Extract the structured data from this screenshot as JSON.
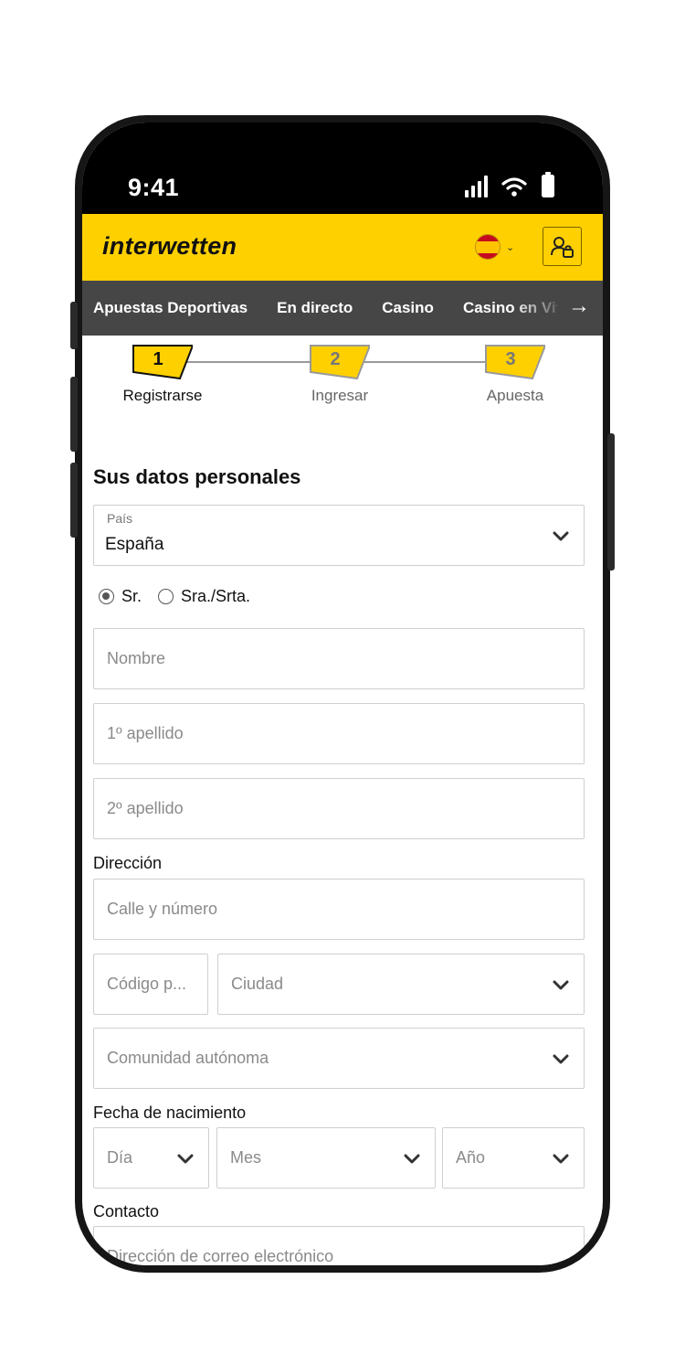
{
  "status_bar": {
    "time": "9:41"
  },
  "header": {
    "logo": "interwetten",
    "language": "ES"
  },
  "nav": {
    "items": [
      "Apuestas Deportivas",
      "En directo",
      "Casino",
      "Casino en Vivo"
    ]
  },
  "stepper": {
    "steps": [
      {
        "number": "1",
        "label": "Registrarse",
        "active": true
      },
      {
        "number": "2",
        "label": "Ingresar",
        "active": false
      },
      {
        "number": "3",
        "label": "Apuesta",
        "active": false
      }
    ]
  },
  "form": {
    "title": "Sus datos personales",
    "country": {
      "label": "País",
      "value": "España"
    },
    "salutation": {
      "options": [
        "Sr.",
        "Sra./Srta."
      ],
      "selected": "Sr."
    },
    "first_name": {
      "placeholder": "Nombre"
    },
    "last_name_1": {
      "placeholder": "1º apellido"
    },
    "last_name_2": {
      "placeholder": "2º apellido"
    },
    "address": {
      "label": "Dirección",
      "street": {
        "placeholder": "Calle y número"
      },
      "postal_code": {
        "placeholder": "Código p..."
      },
      "city": {
        "placeholder": "Ciudad"
      },
      "region": {
        "placeholder": "Comunidad autónoma"
      }
    },
    "birthdate": {
      "label": "Fecha de nacimiento",
      "day": {
        "placeholder": "Día"
      },
      "month": {
        "placeholder": "Mes"
      },
      "year": {
        "placeholder": "Año"
      }
    },
    "contact": {
      "label": "Contacto",
      "email": {
        "placeholder": "Dirección de correo electrónico"
      }
    }
  },
  "colors": {
    "brand_yellow": "#ffd000",
    "nav_bg": "#464646",
    "border": "#cfcfcf"
  }
}
